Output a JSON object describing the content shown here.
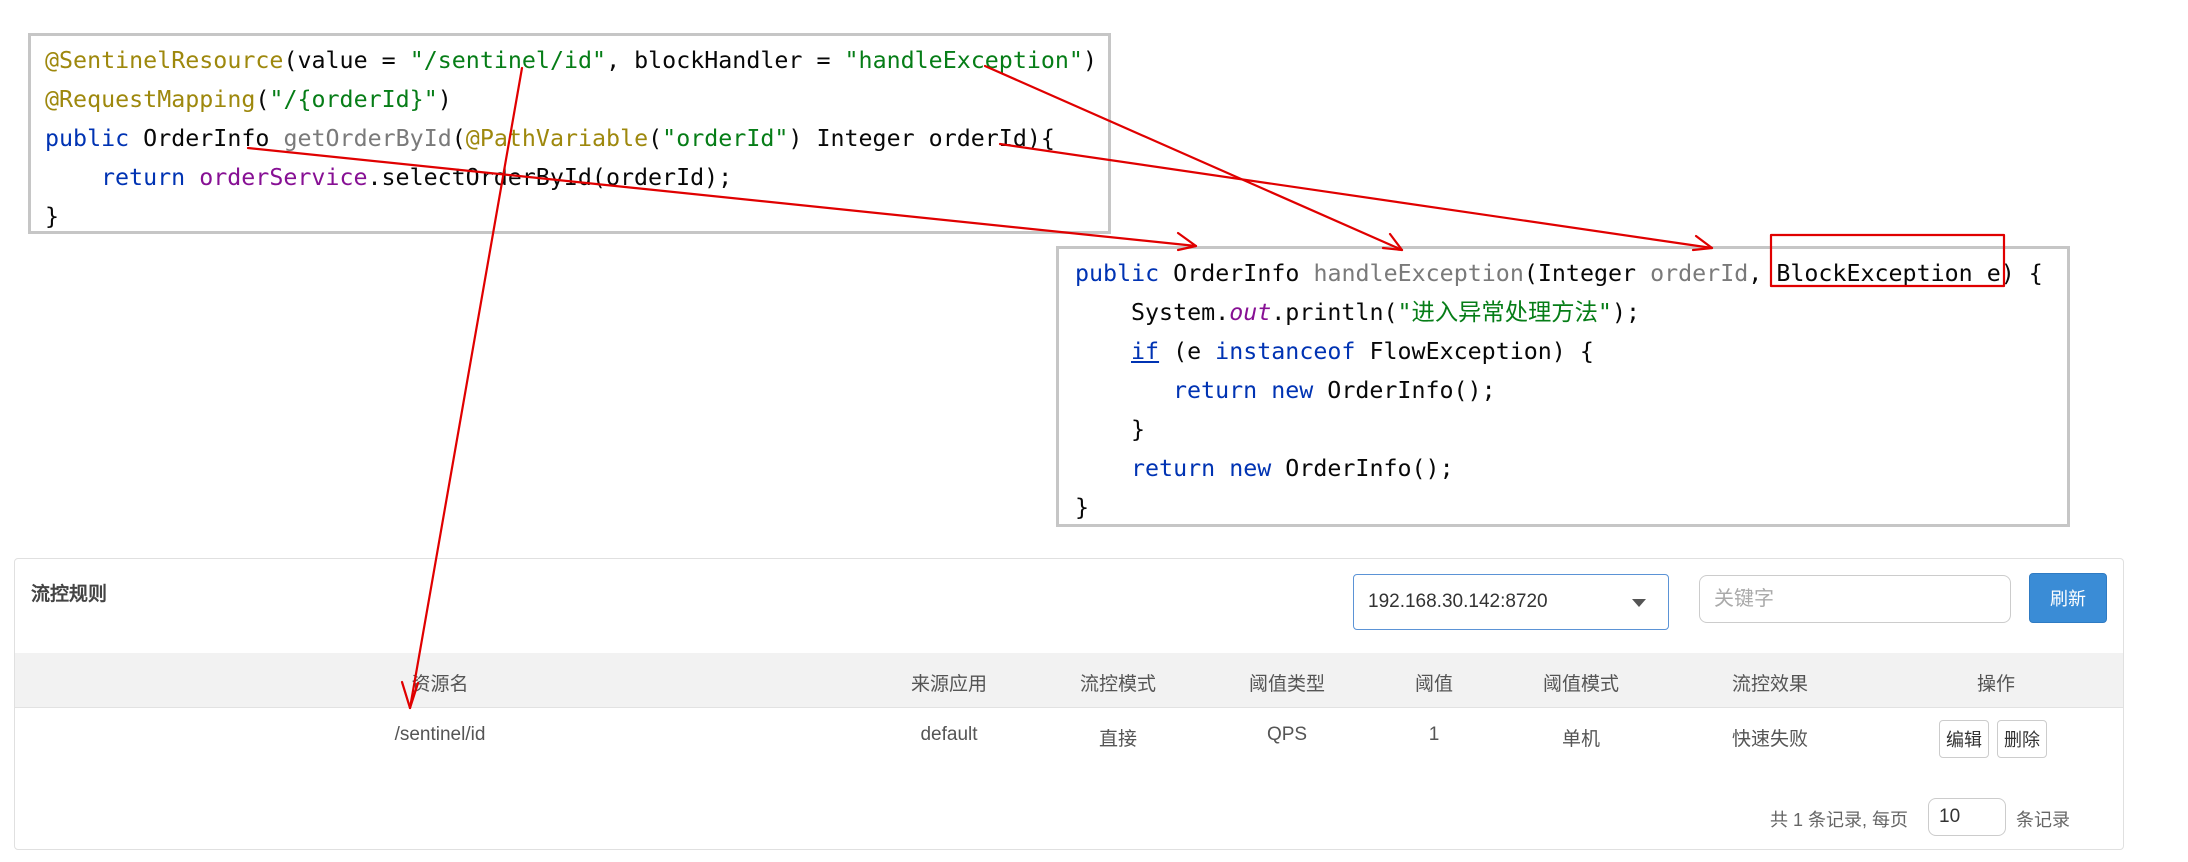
{
  "code_top": {
    "line1": {
      "annotation": "@SentinelResource",
      "open": "(value = ",
      "value_str": "\"/sentinel/id\"",
      "mid": ", blockHandler = ",
      "handler_str": "\"handleException\"",
      "close": ")"
    },
    "line2": {
      "annotation": "@RequestMapping",
      "open": "(",
      "path_str": "\"/{orderId}\"",
      "close": ")"
    },
    "line3": {
      "kw_public": "public",
      "type": " OrderInfo ",
      "method": "getOrderById",
      "open": "(",
      "param_ann": "@PathVariable",
      "p_open": "(",
      "param_str": "\"orderId\"",
      "rest": ") Integer orderId){"
    },
    "line4": {
      "kw_return": "return",
      "field": "orderService",
      "call": ".selectOrderById(orderId);"
    },
    "line5": {
      "brace": "}"
    }
  },
  "code_right": {
    "line1": {
      "kw_public": "public",
      "type": " OrderInfo ",
      "method": "handleException",
      "open": "(Integer ",
      "param1": "orderId",
      "sep": ", ",
      "param2_type": "BlockException",
      "param2_name": " e) {"
    },
    "line2": {
      "prefix": "System.",
      "field": "out",
      "call": ".println(",
      "str": "\"进入异常处理方法\"",
      "end": ");"
    },
    "line3": {
      "kw_if": "if",
      "open": " (e ",
      "kw_instanceof": "instanceof",
      "rest": " FlowException) {"
    },
    "line4": {
      "kw_return": "return",
      "kw_new": "new",
      "rest": " OrderInfo();"
    },
    "line5": {
      "brace": "}"
    },
    "line6": {
      "kw_return": "return",
      "kw_new": "new",
      "rest": " OrderInfo();"
    },
    "line7": {
      "brace": "}"
    }
  },
  "panel": {
    "title": "流控规则",
    "machine_select": "192.168.30.142:8720",
    "search_placeholder": "关键字",
    "refresh_label": "刷新"
  },
  "table": {
    "headers": {
      "resource": "资源名",
      "origin": "来源应用",
      "flow_mode": "流控模式",
      "threshold_type": "阈值类型",
      "threshold": "阈值",
      "threshold_mode": "阈值模式",
      "effect": "流控效果",
      "ops": "操作"
    },
    "rows": [
      {
        "resource": "/sentinel/id",
        "origin": "default",
        "flow_mode": "直接",
        "threshold_type": "QPS",
        "threshold": "1",
        "threshold_mode": "单机",
        "effect": "快速失败",
        "edit_label": "编辑",
        "delete_label": "删除"
      }
    ]
  },
  "pagination": {
    "prefix": "共 1 条记录, 每页",
    "page_size": "10",
    "suffix": "条记录"
  },
  "annotation_color": "#e00000"
}
